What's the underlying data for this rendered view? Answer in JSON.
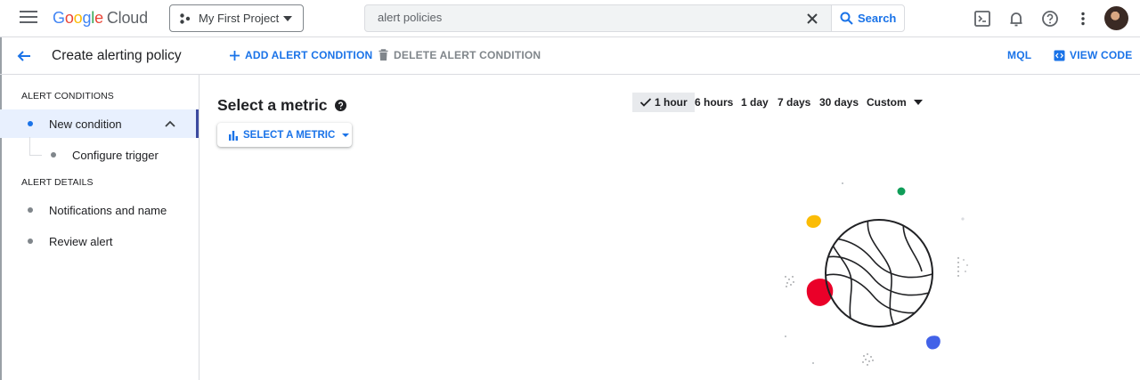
{
  "header": {
    "logo_parts": [
      "G",
      "o",
      "o",
      "g",
      "l",
      "e"
    ],
    "logo_product": "Cloud",
    "project_name": "My First Project",
    "search_value": "alert policies",
    "search_button": "Search"
  },
  "subbar": {
    "page_title": "Create alerting policy",
    "add_condition": "ADD ALERT CONDITION",
    "delete_condition": "DELETE ALERT CONDITION",
    "mql": "MQL",
    "view_code": "VIEW CODE"
  },
  "sidebar": {
    "section_conditions": "ALERT CONDITIONS",
    "new_condition": "New condition",
    "configure_trigger": "Configure trigger",
    "section_details": "ALERT DETAILS",
    "notifications": "Notifications and name",
    "review": "Review alert"
  },
  "main": {
    "title": "Select a metric",
    "select_metric_button": "SELECT A METRIC",
    "time_ranges": [
      "1 hour",
      "6 hours",
      "1 day",
      "7 days",
      "30 days",
      "Custom"
    ],
    "selected_range": "1 hour"
  },
  "colors": {
    "accent": "#1a73e8",
    "active_bg": "#e8f0fe",
    "illus_red": "#ea0029",
    "illus_yellow": "#fbbc05",
    "illus_green": "#0f9d58",
    "illus_blue": "#4262e8"
  },
  "icons": [
    "menu-icon",
    "project-icon",
    "close-icon",
    "search-icon",
    "terminal-icon",
    "bell-icon",
    "help-icon",
    "more-vert-icon",
    "back-arrow-icon",
    "plus-icon",
    "trash-icon",
    "code-icon",
    "chevron-up-icon",
    "bar-chart-icon",
    "check-icon"
  ]
}
